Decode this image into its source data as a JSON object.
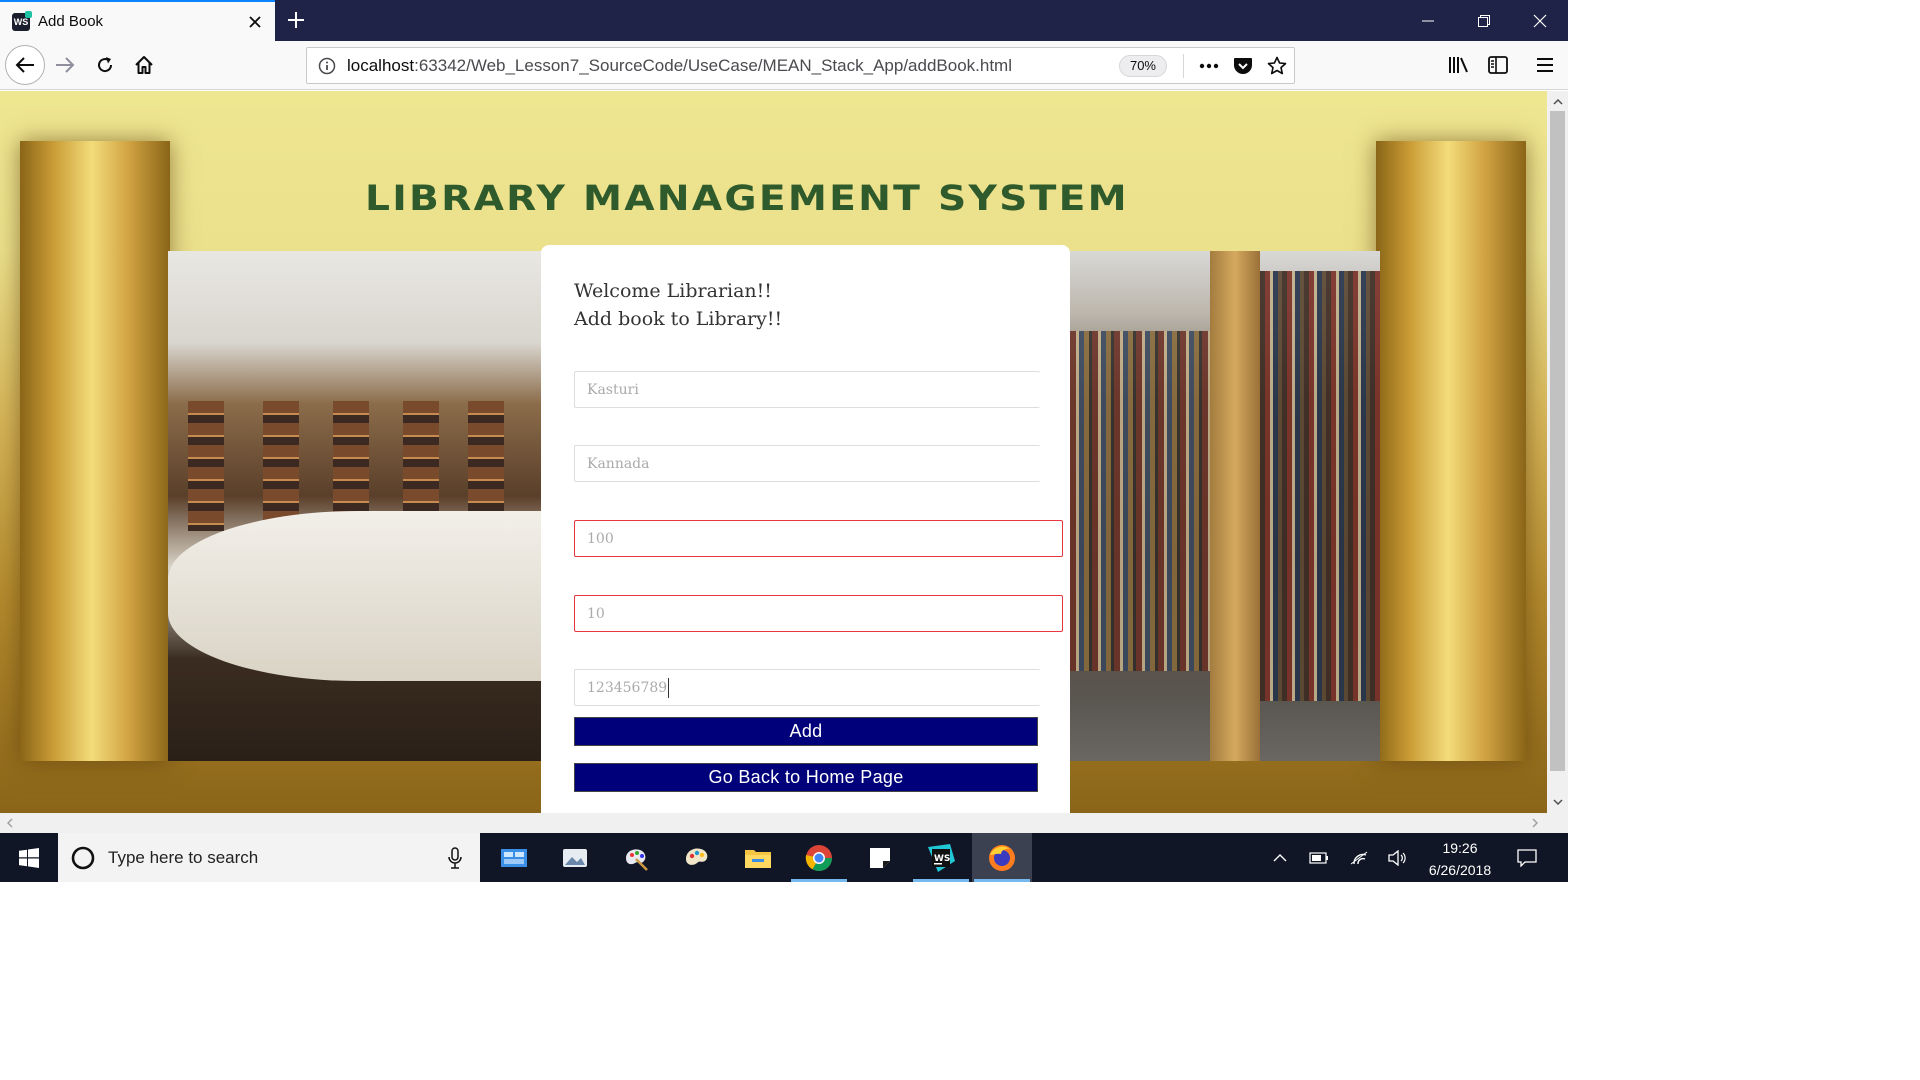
{
  "browser": {
    "tab": {
      "title": "Add Book",
      "favicon_text": "WS"
    },
    "url": {
      "host": "localhost",
      "rest": ":63342/Web_Lesson7_SourceCode/UseCase/MEAN_Stack_App/addBook.html"
    },
    "zoom": "70%"
  },
  "page": {
    "heading": "LIBRARY MANAGEMENT SYSTEM",
    "welcome_line1": "Welcome Librarian!!",
    "welcome_line2": "Add book to Library!!",
    "fields": [
      {
        "value": "Kasturi",
        "state": "normal"
      },
      {
        "value": "Kannada",
        "state": "normal"
      },
      {
        "value": "100",
        "state": "invalid"
      },
      {
        "value": "10",
        "state": "invalid"
      },
      {
        "value": "123456789",
        "state": "focused"
      }
    ],
    "add_button": "Add",
    "home_button": "Go Back to Home Page"
  },
  "taskbar": {
    "search_placeholder": "Type here to search",
    "time": "19:26",
    "date": "6/26/2018"
  },
  "colors": {
    "button_bg": "#00007a",
    "invalid_border": "#e8373f",
    "heading": "#2f5a2c"
  }
}
